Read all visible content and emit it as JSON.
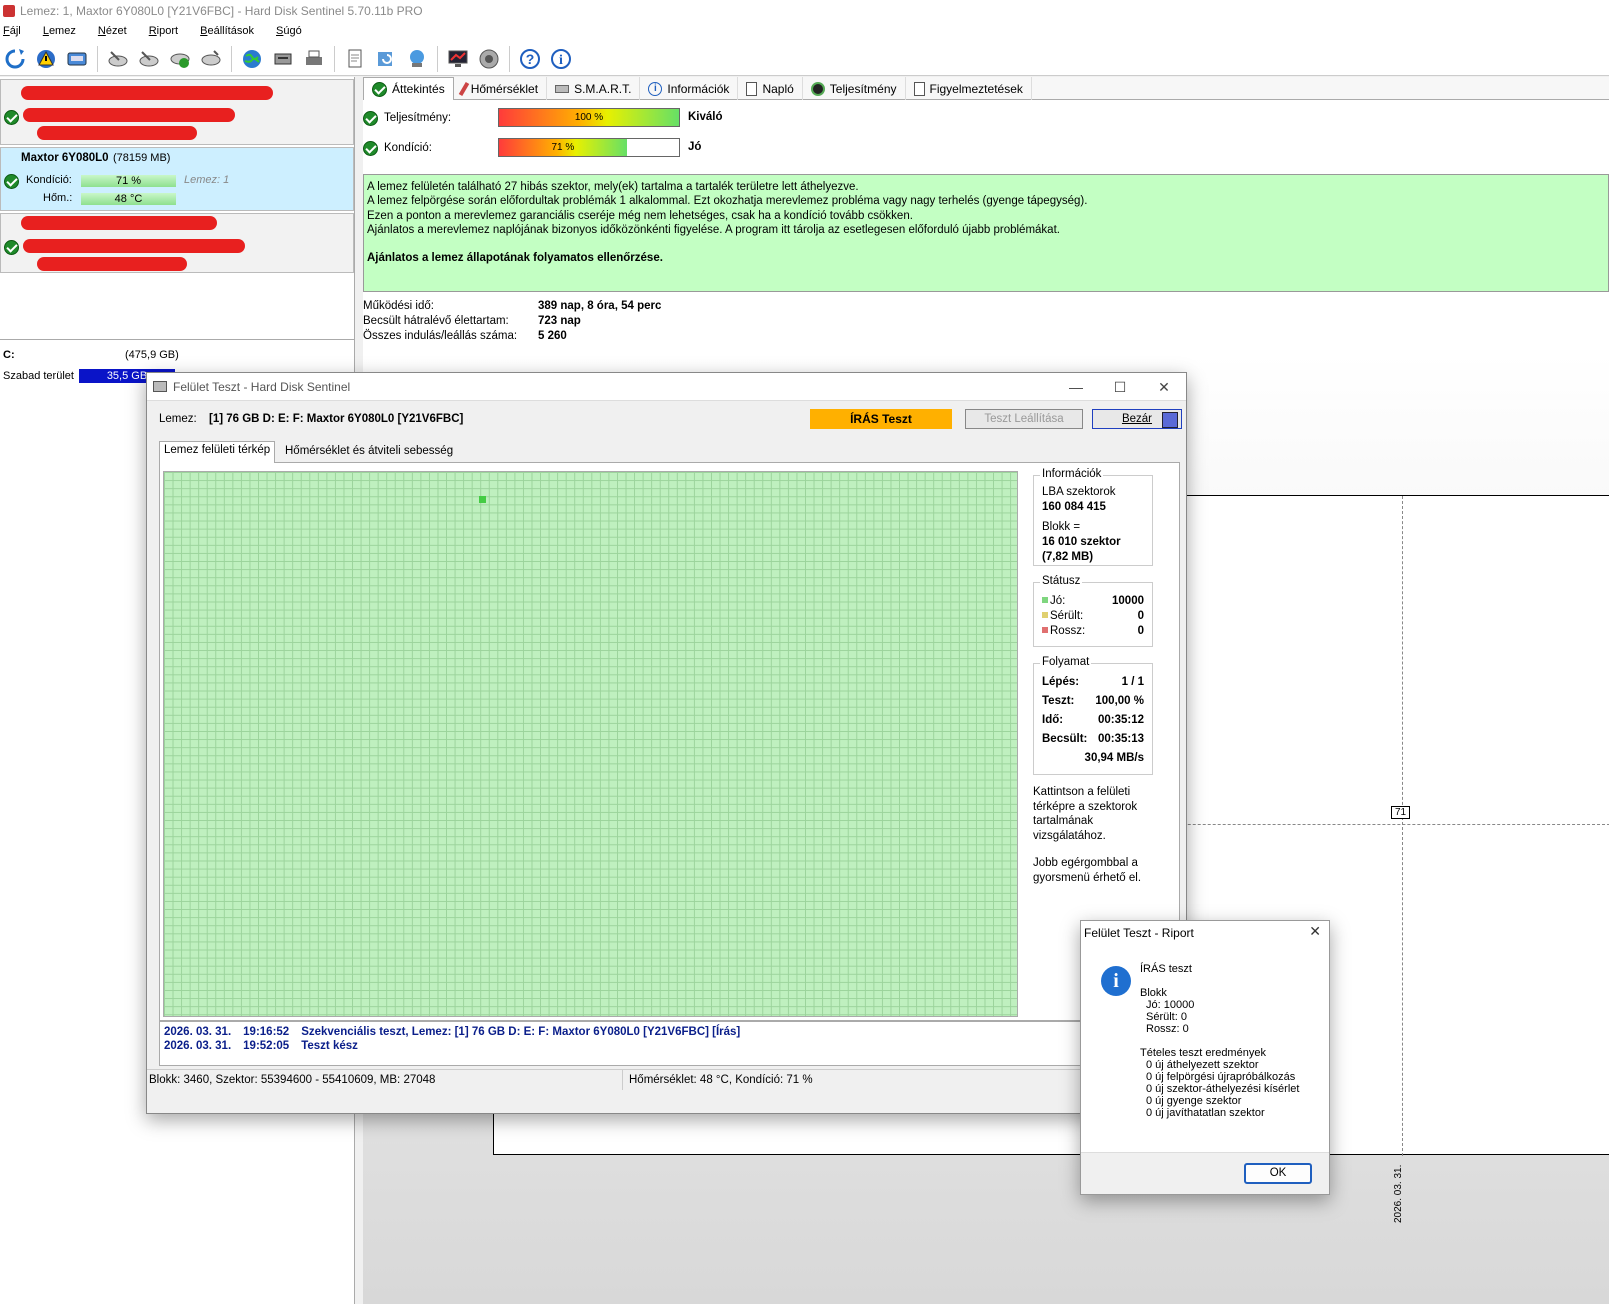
{
  "window": {
    "title": "Lemez: 1, Maxtor 6Y080L0 [Y21V6FBC]  -  Hard Disk Sentinel 5.70.11b PRO"
  },
  "menu": [
    "Fájl",
    "Lemez",
    "Nézet",
    "Riport",
    "Beállítások",
    "Súgó"
  ],
  "toolbar": {
    "icons": [
      "refresh-icon",
      "warning-icon",
      "disk-icon",
      "disk-test-icon",
      "disk-test-icon",
      "disk-ok-icon",
      "disk-tool-icon",
      "globe-icon",
      "server-icon",
      "printer-icon",
      "report-icon",
      "sync-icon",
      "network-icon",
      "monitor-icon",
      "speaker-icon",
      "help-icon",
      "info-icon"
    ]
  },
  "left_panel": {
    "selected_disk": {
      "name": "Maxtor 6Y080L0",
      "size": "(78159 MB)",
      "condition_label": "Kondíció:",
      "condition_value": "71 %",
      "condition_percent": 71,
      "disk_ref": "Lemez: 1",
      "temp_label": "Hőm.:",
      "temp_value": "48 °C"
    },
    "partition": {
      "drive": "C:",
      "size": "(475,9 GB)",
      "free_label": "Szabad terület",
      "free_value": "35,5 GB"
    }
  },
  "tabs": [
    "Áttekintés",
    "Hőmérséklet",
    "S.M.A.R.T.",
    "Információk",
    "Napló",
    "Teljesítmény",
    "Figyelmeztetések"
  ],
  "overview": {
    "performance_label": "Teljesítmény:",
    "performance_bar": "100 %",
    "performance_percent": 100,
    "performance_text": "Kiváló",
    "condition_label": "Kondíció:",
    "condition_bar": "71 %",
    "condition_percent": 71,
    "condition_text": "Jó",
    "message_lines": [
      "A lemez felületén található 27 hibás szektor, mely(ek) tartalma a tartalék területre lett áthelyezve.",
      "A lemez felpörgése során előfordultak problémák 1 alkalommal. Ezt okozhatja merevlemez probléma vagy nagy terhelés (gyenge tápegység).",
      "Ezen a ponton a merevlemez garanciális cseréje még nem lehetséges, csak ha a kondíció tovább csökken.",
      "Ajánlatos a merevlemez naplójának bizonyos időközönkénti figyelése. A program itt tárolja az esetlegesen előforduló újabb problémákat."
    ],
    "message_bold": "Ajánlatos a lemez állapotának folyamatos ellenőrzése.",
    "stats": [
      {
        "label": "Működési idő:",
        "value": "389 nap, 8 óra, 54 perc"
      },
      {
        "label": "Becsült hátralévő élettartam:",
        "value": "723 nap"
      },
      {
        "label": "Összes indulás/leállás száma:",
        "value": "5 260"
      }
    ],
    "chart_marker": "71",
    "chart_date": "2026. 03. 31."
  },
  "surface_test": {
    "title": "Felület Teszt - Hard Disk Sentinel",
    "disk_label": "Lemez:",
    "disk_value": "[1] 76 GB D: E: F: Maxtor 6Y080L0 [Y21V6FBC]",
    "mode_badge": "ÍRÁS Teszt",
    "stop_button": "Teszt Leállítása",
    "close_button": "Bezár",
    "tabs": [
      "Lemez felületi térkép",
      "Hőmérséklet és átviteli sebesség"
    ],
    "info": {
      "title": "Információk",
      "lba_label": "LBA szektorok",
      "lba_value": "160 084 415",
      "block_label": "Blokk =",
      "block_value": "16 010 szektor",
      "block_mb": "(7,82 MB)"
    },
    "status": {
      "title": "Státusz",
      "good_label": "Jó:",
      "good_value": "10000",
      "damaged_label": "Sérült:",
      "damaged_value": "0",
      "bad_label": "Rossz:",
      "bad_value": "0",
      "good_color": "#7fd67f",
      "damaged_color": "#e0d070",
      "bad_color": "#e07070"
    },
    "progress": {
      "title": "Folyamat",
      "step_label": "Lépés:",
      "step_value": "1 / 1",
      "test_label": "Teszt:",
      "test_value": "100,00 %",
      "time_label": "Idő:",
      "time_value": "00:35:12",
      "est_label": "Becsült:",
      "est_value": "00:35:13",
      "speed_value": "30,94 MB/s"
    },
    "hint1": "Kattintson a felületi térképre a szektorok tartalmának vizsgálatához.",
    "hint2": "Jobb egérgombbal a gyorsmenü érhető el.",
    "log": [
      {
        "date": "2026. 03. 31.",
        "time": "19:16:52",
        "text": "Szekvenciális teszt, Lemez: [1] 76 GB D: E: F: Maxtor 6Y080L0 [Y21V6FBC] [Írás]"
      },
      {
        "date": "2026. 03. 31.",
        "time": "19:52:05",
        "text": "Teszt kész"
      }
    ],
    "status_left": "Blokk: 3460, Szektor: 55394600 - 55410609, MB: 27048",
    "status_right": "Hőmérséklet: 48  °C,  Kondíció: 71 %"
  },
  "report": {
    "title": "Felület Teszt - Riport",
    "heading": "ÍRÁS teszt",
    "block_title": "Blokk",
    "good": "Jó: 10000",
    "damaged": "Sérült: 0",
    "bad": "Rossz: 0",
    "results_title": "Tételes teszt eredmények",
    "results": [
      "0 új áthelyezett szektor",
      "0 új felpörgési újrapróbálkozás",
      "0 új szektor-áthelyezési kísérlet",
      "0 új gyenge szektor",
      "0 új javíthatatlan szektor"
    ],
    "ok_button": "OK"
  }
}
